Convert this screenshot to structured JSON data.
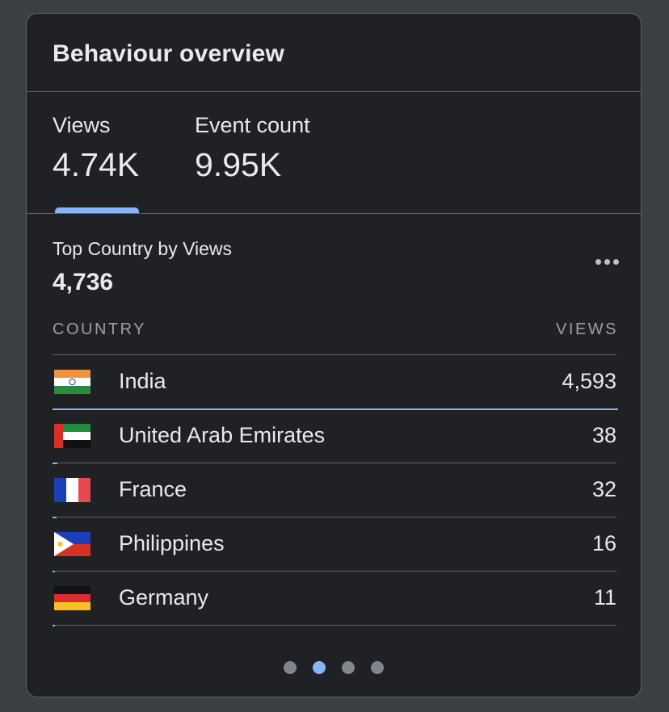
{
  "card": {
    "title": "Behaviour overview"
  },
  "metrics": [
    {
      "label": "Views",
      "value": "4.74K",
      "selected": true
    },
    {
      "label": "Event count",
      "value": "9.95K",
      "selected": false
    }
  ],
  "section": {
    "title": "Top Country by Views",
    "total": "4,736",
    "more_icon": "more-horizontal-icon"
  },
  "table": {
    "headers": {
      "country": "COUNTRY",
      "views": "VIEWS"
    },
    "rows": [
      {
        "country": "India",
        "views": "4,593",
        "views_value": 4593,
        "flag": "india-flag-icon"
      },
      {
        "country": "United Arab Emirates",
        "views": "38",
        "views_value": 38,
        "flag": "uae-flag-icon"
      },
      {
        "country": "France",
        "views": "32",
        "views_value": 32,
        "flag": "france-flag-icon"
      },
      {
        "country": "Philippines",
        "views": "16",
        "views_value": 16,
        "flag": "philippines-flag-icon"
      },
      {
        "country": "Germany",
        "views": "11",
        "views_value": 11,
        "flag": "germany-flag-icon"
      }
    ],
    "bar_color": "#8ab4f8"
  },
  "pager": {
    "pages": 4,
    "current": 2
  },
  "colors": {
    "accent": "#8ab4f8",
    "card_background": "#202124",
    "page_background": "#3b3e43",
    "border": "#5f6368",
    "text": "#e8eaed",
    "muted_text": "#9aa0a6"
  }
}
